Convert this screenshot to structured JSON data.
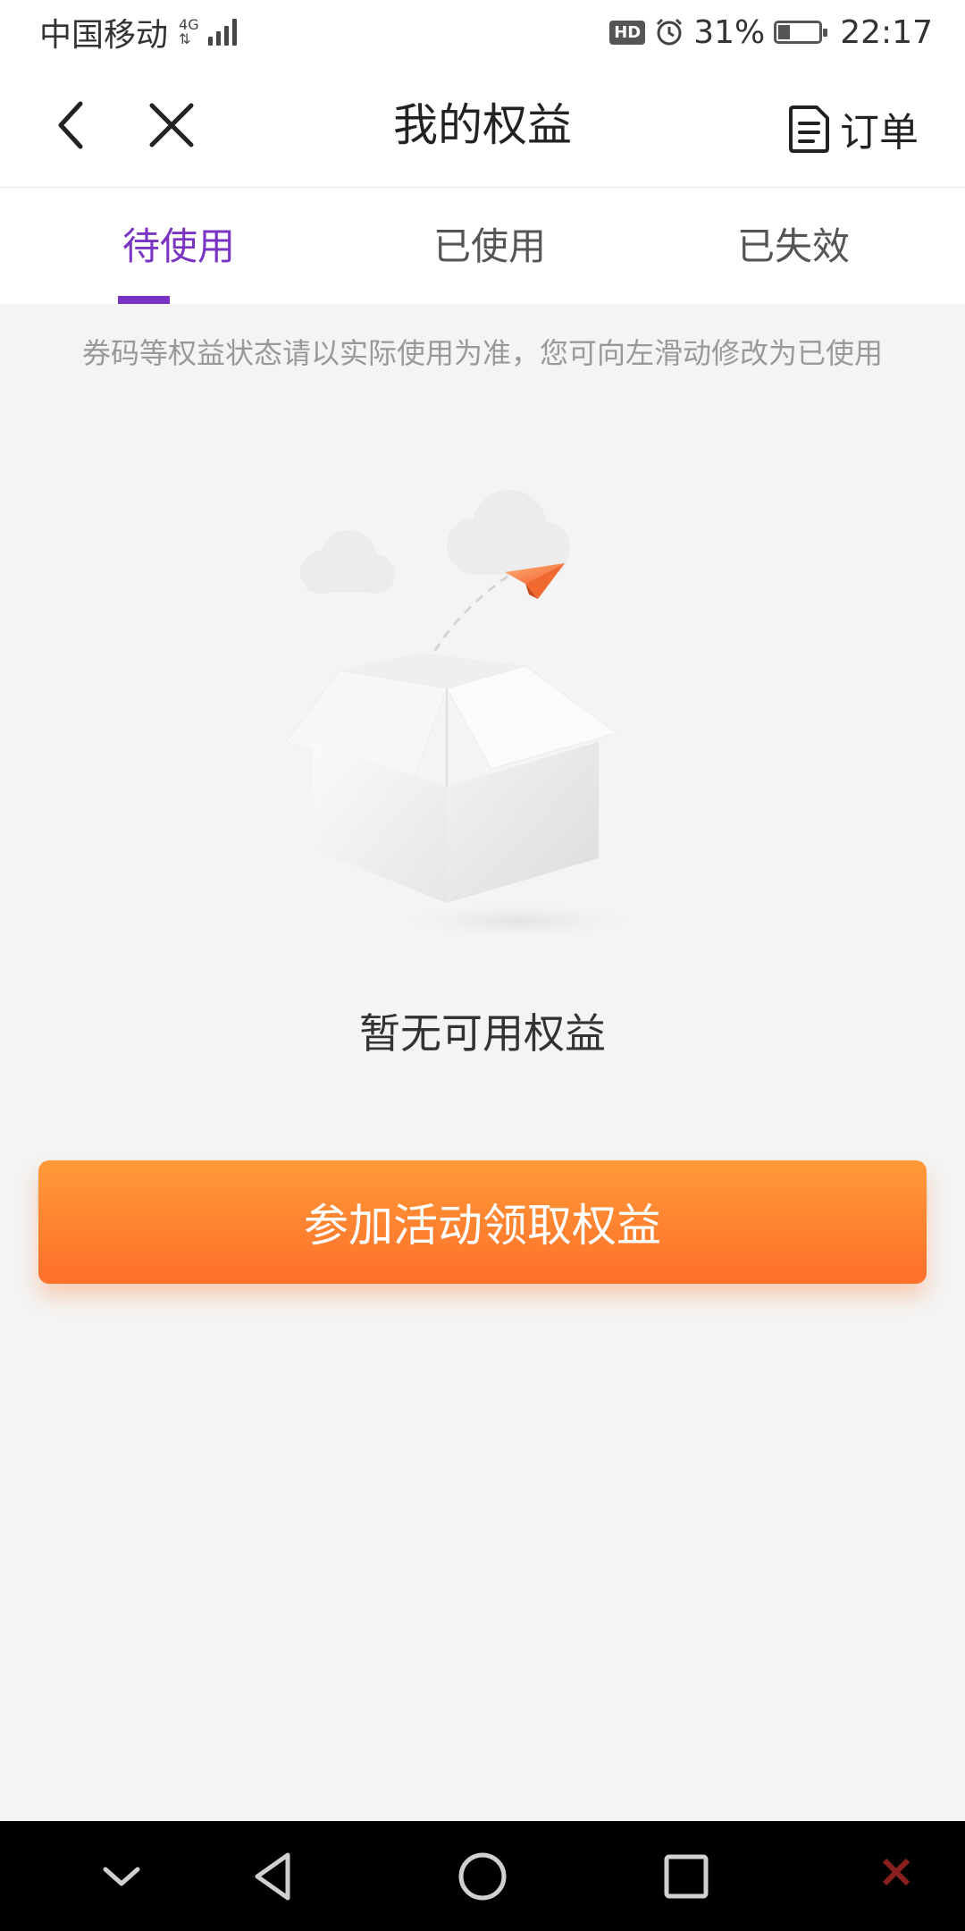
{
  "status_bar": {
    "carrier": "中国移动",
    "network": "4G",
    "time": "22:17",
    "battery_percent": "31%",
    "battery_level": 0.31,
    "hd_label": "HD"
  },
  "header": {
    "title": "我的权益",
    "order_label": "订单"
  },
  "tabs": [
    {
      "label": "待使用",
      "active": true
    },
    {
      "label": "已使用",
      "active": false
    },
    {
      "label": "已失效",
      "active": false
    }
  ],
  "notice": "券码等权益状态请以实际使用为准，您可向左滑动修改为已使用",
  "empty_state": {
    "message": "暂无可用权益"
  },
  "cta": {
    "label": "参加活动领取权益"
  },
  "colors": {
    "accent": "#7a34c4",
    "cta_top": "#ff9a38",
    "cta_bottom": "#ff6f2a",
    "background": "#f4f4f4"
  }
}
